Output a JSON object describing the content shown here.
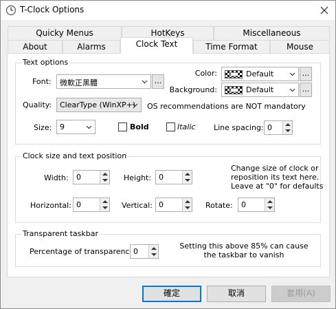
{
  "window": {
    "title": "T-Clock Options"
  },
  "tabs": {
    "row1": [
      "Quicky Menus",
      "HotKeys",
      "Miscellaneous"
    ],
    "row2": [
      "About",
      "Alarms",
      "Clock Text",
      "Time Format",
      "Mouse"
    ],
    "active": "Clock Text"
  },
  "text_options": {
    "group_title": "Text options",
    "font_label": "Font:",
    "font_value": "微軟正黑體",
    "color_label": "Color:",
    "color_value": "Default",
    "background_label": "Background:",
    "background_value": "Default",
    "quality_label": "Quality:",
    "quality_value": "ClearType (WinXP+)",
    "quality_note": "OS recommendations are NOT mandatory",
    "size_label": "Size:",
    "size_value": "9",
    "bold_label": "Bold",
    "italic_label": "Italic",
    "line_spacing_label": "Line spacing:",
    "line_spacing_value": "0",
    "dots_label": "..."
  },
  "clock_size": {
    "group_title": "Clock size and text position",
    "width_label": "Width:",
    "width_value": "0",
    "height_label": "Height:",
    "height_value": "0",
    "horizontal_label": "Horizontal:",
    "horizontal_value": "0",
    "vertical_label": "Vertical:",
    "vertical_value": "0",
    "rotate_label": "Rotate:",
    "rotate_value": "0",
    "note_line1": "Change size of clock or",
    "note_line2": "reposition its text here.",
    "note_line3": "Leave at \"0\" for defaults"
  },
  "transparent": {
    "group_title": "Transparent taskbar",
    "percent_label": "Percentage of transparency:",
    "percent_value": "0",
    "note_line1": "Setting this above 85% can cause",
    "note_line2": "the taskbar to vanish"
  },
  "buttons": {
    "ok": "確定",
    "cancel": "取消",
    "apply": "套用(A)"
  },
  "colors": {
    "accent": "#0078d7"
  }
}
